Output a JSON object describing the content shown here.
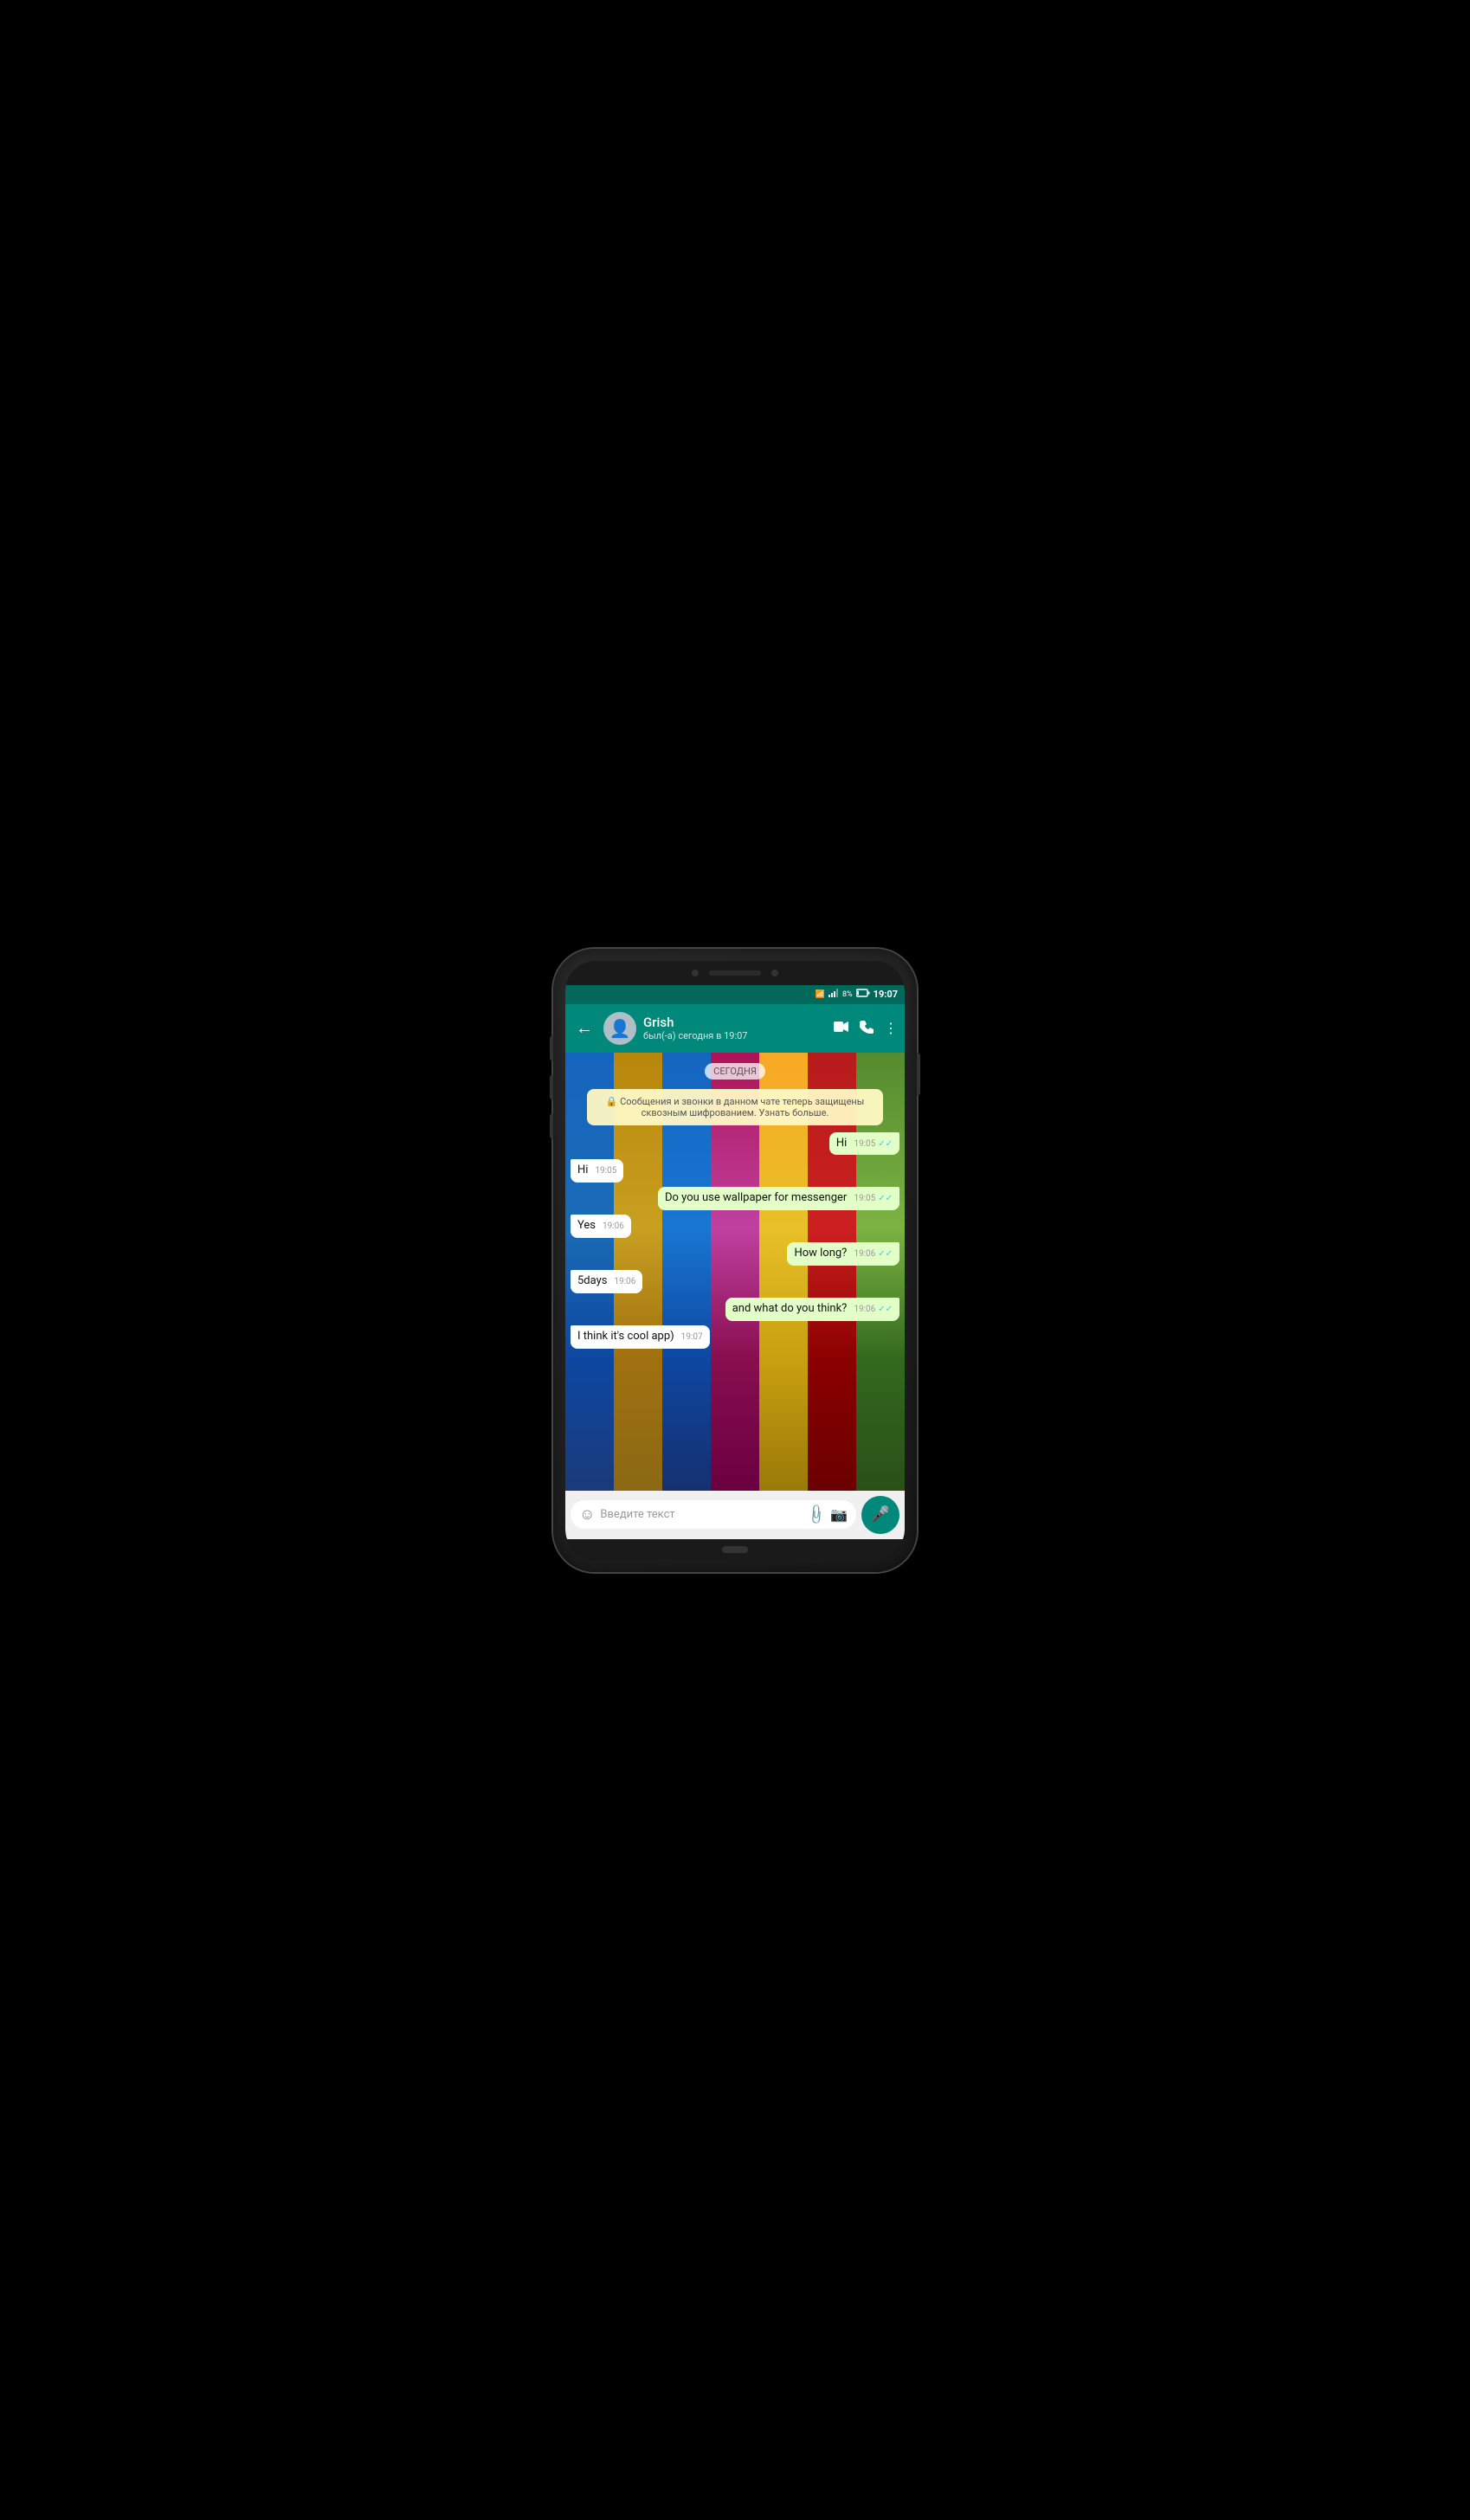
{
  "phone": {
    "status_bar": {
      "wifi_icon": "📶",
      "signal_icon": "📶",
      "battery_percent": "8%",
      "battery_icon": "🔋",
      "time": "19:07"
    },
    "header": {
      "back_label": "←",
      "contact_name": "Grish",
      "contact_status": "был(-а) сегодня в 19:07",
      "video_icon": "🎥",
      "call_icon": "📞",
      "more_icon": "⋮"
    },
    "date_badge": "СЕГОДНЯ",
    "encryption_notice": "🔒 Сообщения и звонки в данном чате теперь защищены сквозным шифрованием. Узнать больше.",
    "messages": [
      {
        "id": 1,
        "type": "sent",
        "text": "Hi",
        "time": "19:05",
        "read": true
      },
      {
        "id": 2,
        "type": "received",
        "text": "Hi",
        "time": "19:05"
      },
      {
        "id": 3,
        "type": "sent",
        "text": "Do you use wallpaper for messenger",
        "time": "19:05",
        "read": true
      },
      {
        "id": 4,
        "type": "received",
        "text": "Yes",
        "time": "19:06"
      },
      {
        "id": 5,
        "type": "sent",
        "text": "How long?",
        "time": "19:06",
        "read": true
      },
      {
        "id": 6,
        "type": "received",
        "text": "5days",
        "time": "19:06"
      },
      {
        "id": 7,
        "type": "sent",
        "text": "and what do you think?",
        "time": "19:06",
        "read": true
      },
      {
        "id": 8,
        "type": "received",
        "text": "I think it's cool app)",
        "time": "19:07"
      }
    ],
    "input": {
      "placeholder": "Введите текст"
    },
    "planks": [
      {
        "color": "#1a6bb5"
      },
      {
        "color": "#c8a020"
      },
      {
        "color": "#1a6bb5"
      },
      {
        "color": "#c040a0"
      },
      {
        "color": "#c8a020"
      },
      {
        "color": "#cc2020"
      },
      {
        "color": "#88bb22"
      }
    ]
  }
}
